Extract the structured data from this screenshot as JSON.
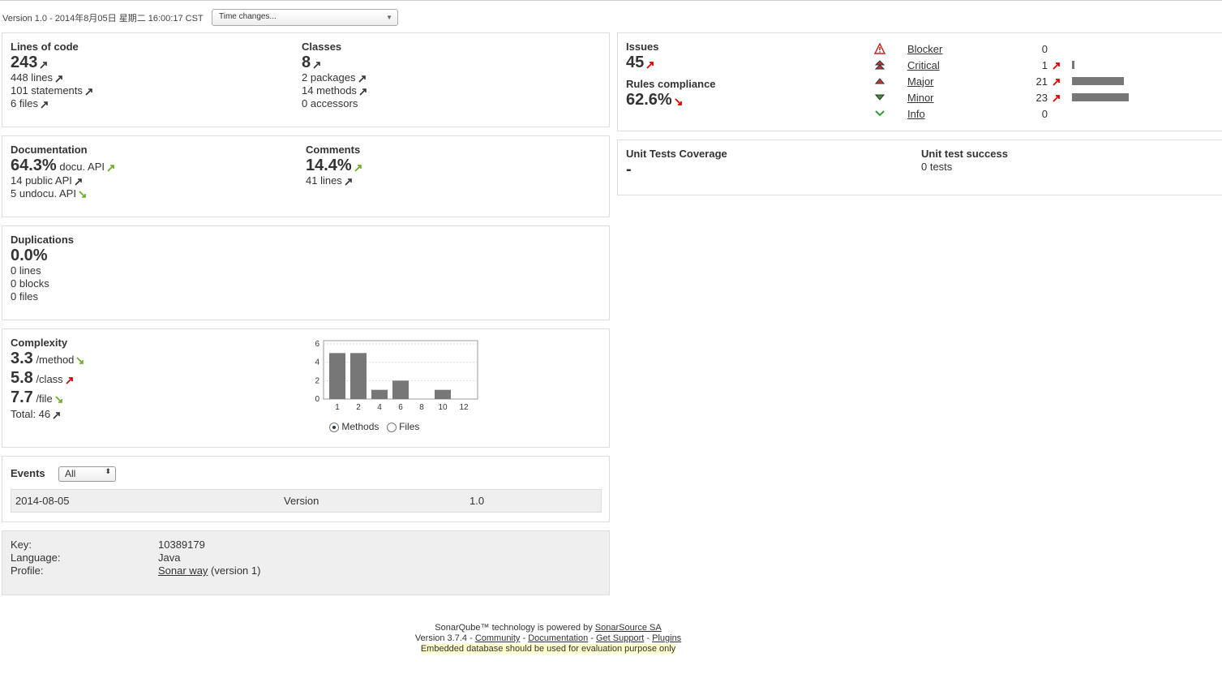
{
  "version_text": "Version 1.0 - 2014年8月05日 星期二 16:00:17 CST",
  "time_changes": "Time changes...",
  "loc": {
    "title": "Lines of code",
    "value": "243",
    "lines": "448 lines",
    "statements": "101 statements",
    "files": "6 files"
  },
  "classes": {
    "title": "Classes",
    "value": "8",
    "packages": "2 packages",
    "methods": "14 methods",
    "accessors": "0 accessors"
  },
  "documentation": {
    "title": "Documentation",
    "value": "64.3%",
    "value_suffix": "docu. API",
    "public_api": "14 public API",
    "undocu_api": "5 undocu. API"
  },
  "comments": {
    "title": "Comments",
    "value": "14.4%",
    "lines": "41 lines"
  },
  "duplications": {
    "title": "Duplications",
    "value": "0.0%",
    "lines": "0 lines",
    "blocks": "0 blocks",
    "files": "0 files"
  },
  "complexity": {
    "title": "Complexity",
    "per_method": "3.3",
    "per_method_unit": "/method",
    "per_class": "5.8",
    "per_class_unit": "/class",
    "per_file": "7.7",
    "per_file_unit": "/file",
    "total": "Total: 46",
    "radio_methods": "Methods",
    "radio_files": "Files"
  },
  "chart_data": {
    "type": "bar",
    "categories": [
      "1",
      "2",
      "4",
      "6",
      "8",
      "10",
      "12"
    ],
    "values": [
      5,
      5,
      1,
      2,
      0,
      1,
      0
    ],
    "yticks": [
      "0",
      "2",
      "4",
      "6"
    ],
    "ylim": [
      0,
      6
    ],
    "grid": true,
    "bar_color": "#777777"
  },
  "events": {
    "title": "Events",
    "filter": "All",
    "rows": [
      {
        "date": "2014-08-05",
        "category": "Version",
        "name": "1.0"
      }
    ]
  },
  "meta": {
    "key_label": "Key:",
    "key": "10389179",
    "language_label": "Language:",
    "language": "Java",
    "profile_label": "Profile:",
    "profile_link": "Sonar way",
    "profile_suffix": "(version 1)"
  },
  "issues": {
    "title": "Issues",
    "value": "45",
    "compliance_title": "Rules compliance",
    "compliance_value": "62.6%",
    "severities": [
      {
        "name": "Blocker",
        "count": "0",
        "fraction": 0
      },
      {
        "name": "Critical",
        "count": "1",
        "fraction": 0.04
      },
      {
        "name": "Major",
        "count": "21",
        "fraction": 0.91
      },
      {
        "name": "Minor",
        "count": "23",
        "fraction": 1.0
      },
      {
        "name": "Info",
        "count": "0",
        "fraction": 0
      }
    ]
  },
  "unit_tests": {
    "coverage_title": "Unit Tests Coverage",
    "coverage_value": "-",
    "success_title": "Unit test success",
    "success_value": "0 tests"
  },
  "footer": {
    "powered_prefix": "SonarQube™ technology is powered by",
    "powered_link": "SonarSource SA",
    "version_prefix": "Version 3.7.4 -",
    "links": [
      "Community",
      "Documentation",
      "Get Support",
      "Plugins"
    ],
    "warning": "Embedded database should be used for evaluation purpose only"
  },
  "colors": {
    "arrow_dark": "#333333",
    "arrow_red": "#dd0000",
    "arrow_green": "#66aa22",
    "bar": "#777777"
  }
}
